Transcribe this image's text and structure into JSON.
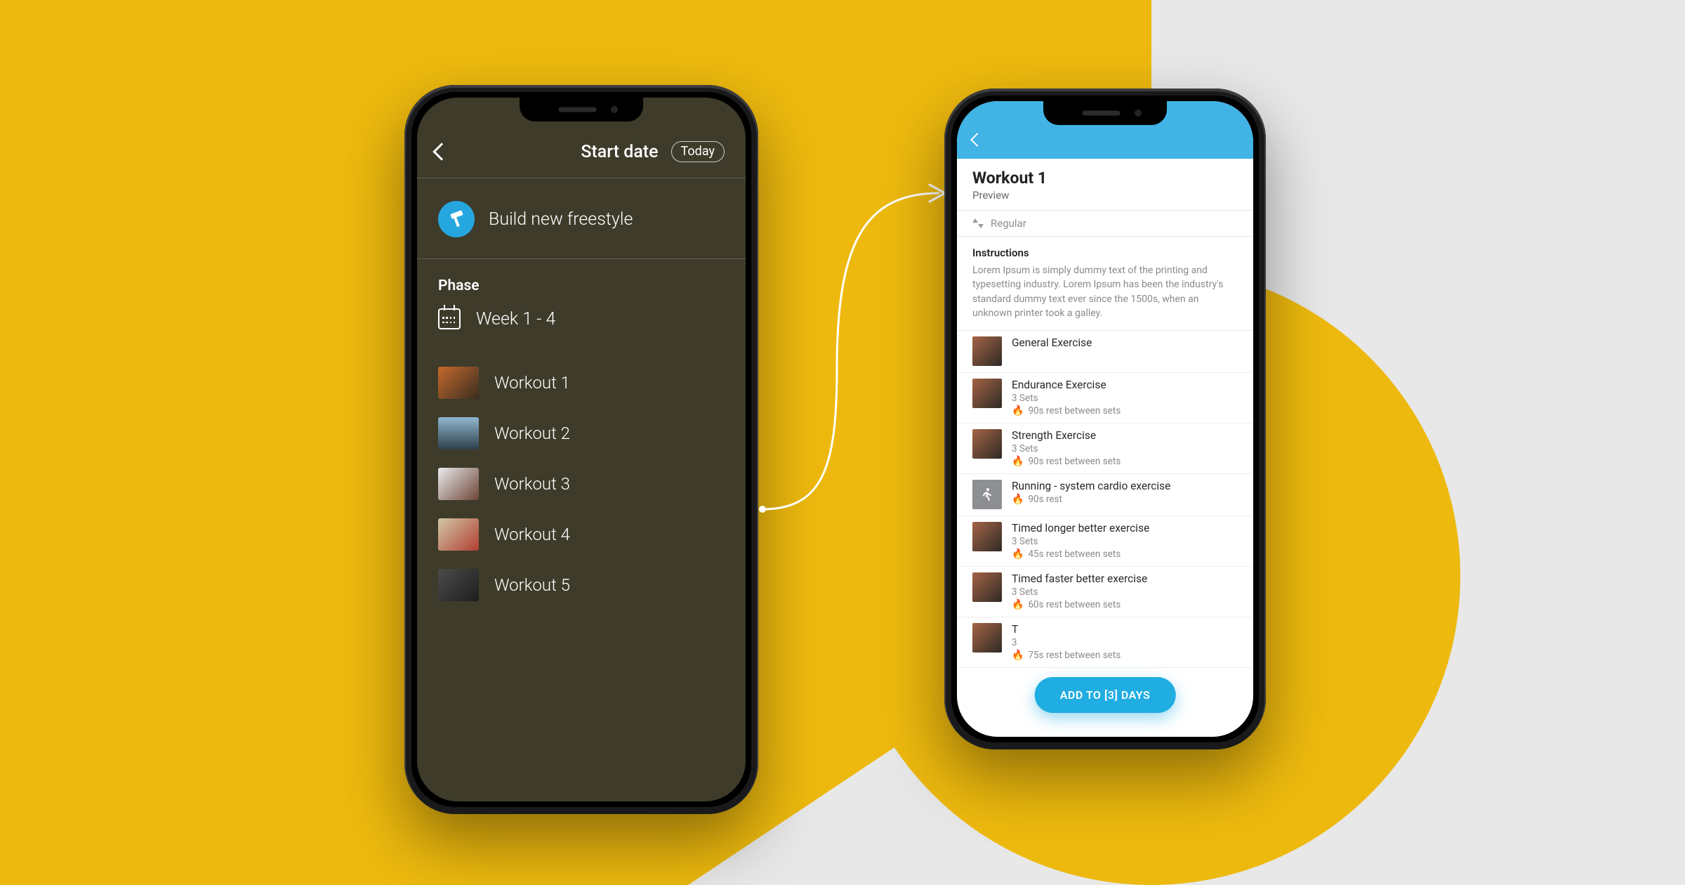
{
  "colors": {
    "brand_blue": "#26a6df",
    "cta_blue": "#20ade1",
    "bg_dark": "#3e3b2a",
    "bg_yellow": "#edb90e",
    "bg_gray": "#e8e8e8"
  },
  "phone_a": {
    "header": {
      "title": "Start date",
      "pill": "Today"
    },
    "build_label": "Build new freestyle",
    "phase_title": "Phase",
    "phase_range": "Week 1 - 4",
    "workouts": [
      {
        "label": "Workout 1"
      },
      {
        "label": "Workout 2"
      },
      {
        "label": "Workout 3"
      },
      {
        "label": "Workout 4"
      },
      {
        "label": "Workout 5"
      }
    ]
  },
  "phone_b": {
    "title": "Workout 1",
    "subtitle": "Preview",
    "mode_label": "Regular",
    "instructions_heading": "Instructions",
    "instructions_body": "Lorem Ipsum is simply dummy text of the printing and typesetting industry. Lorem Ipsum has been the industry's standard dummy text ever since the 1500s, when an unknown printer took a galley.",
    "exercises": [
      {
        "name": "General Exercise",
        "sets": "",
        "rest": ""
      },
      {
        "name": "Endurance Exercise",
        "sets": "3 Sets",
        "rest": "90s rest between sets"
      },
      {
        "name": "Strength Exercise",
        "sets": "3 Sets",
        "rest": "90s rest between sets"
      },
      {
        "name": "Running - system cardio exercise",
        "sets": "",
        "rest": "90s rest",
        "icon": "run"
      },
      {
        "name": "Timed longer better exercise",
        "sets": "3 Sets",
        "rest": "45s rest between sets"
      },
      {
        "name": "Timed faster better exercise",
        "sets": "3 Sets",
        "rest": "60s rest between sets"
      },
      {
        "name": "T",
        "sets": "3",
        "rest": "75s rest between sets"
      }
    ],
    "cta_label": "ADD TO [3] DAYS"
  }
}
